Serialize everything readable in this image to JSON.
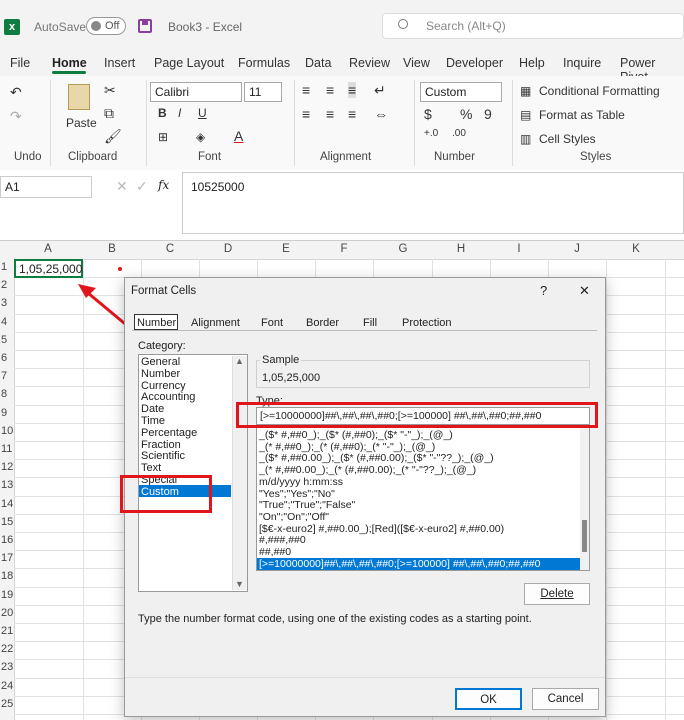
{
  "app": {
    "autosave_label": "AutoSave",
    "autosave_state": "Off",
    "doc_title": "Book3  -  Excel",
    "search_placeholder": "Search (Alt+Q)"
  },
  "menu_tabs": [
    "File",
    "Home",
    "Insert",
    "Page Layout",
    "Formulas",
    "Data",
    "Review",
    "View",
    "Developer",
    "Help",
    "Inquire",
    "Power Pivot"
  ],
  "ribbon": {
    "undo_group": "Undo",
    "clipboard_group": "Clipboard",
    "paste_label": "Paste",
    "font_group": "Font",
    "font_name": "Calibri",
    "font_size": "11",
    "alignment_group": "Alignment",
    "number_group": "Number",
    "number_format": "Custom",
    "styles_group": "Styles",
    "conditional_formatting": "Conditional Formatting",
    "format_as_table": "Format as Table",
    "cell_styles": "Cell Styles"
  },
  "formula_bar": {
    "name_box": "A1",
    "fx": "fx",
    "value": "10525000"
  },
  "grid": {
    "columns": [
      "A",
      "B",
      "C",
      "D",
      "E",
      "F",
      "G",
      "H",
      "I",
      "J",
      "K"
    ],
    "rows": [
      "1",
      "2",
      "3",
      "4",
      "5",
      "6",
      "7",
      "8",
      "9",
      "10",
      "11",
      "12",
      "13",
      "14",
      "15",
      "16",
      "17",
      "18",
      "19",
      "20",
      "21",
      "22",
      "23",
      "24",
      "25"
    ],
    "a1_value": "1,05,25,000"
  },
  "dialog": {
    "title": "Format Cells",
    "help": "?",
    "close": "✕",
    "tabs": [
      "Number",
      "Alignment",
      "Font",
      "Border",
      "Fill",
      "Protection"
    ],
    "category_label": "Category:",
    "categories": [
      "General",
      "Number",
      "Currency",
      "Accounting",
      "Date",
      "Time",
      "Percentage",
      "Fraction",
      "Scientific",
      "Text",
      "Special",
      "Custom"
    ],
    "sample_label": "Sample",
    "sample_value": "1,05,25,000",
    "type_label": "Type:",
    "type_value": "[>=10000000]##\\,##\\,##\\,##0;[>=100000] ##\\,##\\,##0;##,##0",
    "type_list": [
      "_($* #,##0_);_($* (#,##0);_($* \"-\"_);_(@_)",
      "_(* #,##0_);_(* (#,##0);_(* \"-\"_);_(@_)",
      "_($* #,##0.00_);_($* (#,##0.00);_($* \"-\"??_);_(@_)",
      "_(* #,##0.00_);_(* (#,##0.00);_(* \"-\"??_);_(@_)",
      "m/d/yyyy h:mm:ss",
      "\"Yes\";\"Yes\";\"No\"",
      "\"True\";\"True\";\"False\"",
      "\"On\";\"On\";\"Off\"",
      "[$€-x-euro2] #,##0.00_);[Red]([$€-x-euro2] #,##0.00)",
      "#,###,##0",
      "##,##0",
      "[>=10000000]##\\,##\\,##\\,##0;[>=100000] ##\\,##\\,##0;##,##0"
    ],
    "delete_label": "Delete",
    "hint": "Type the number format code, using one of the existing codes as a starting point.",
    "ok_label": "OK",
    "cancel_label": "Cancel"
  },
  "colors": {
    "accent": "#107c41",
    "highlight": "#e0161c",
    "selection": "#0078d4"
  }
}
